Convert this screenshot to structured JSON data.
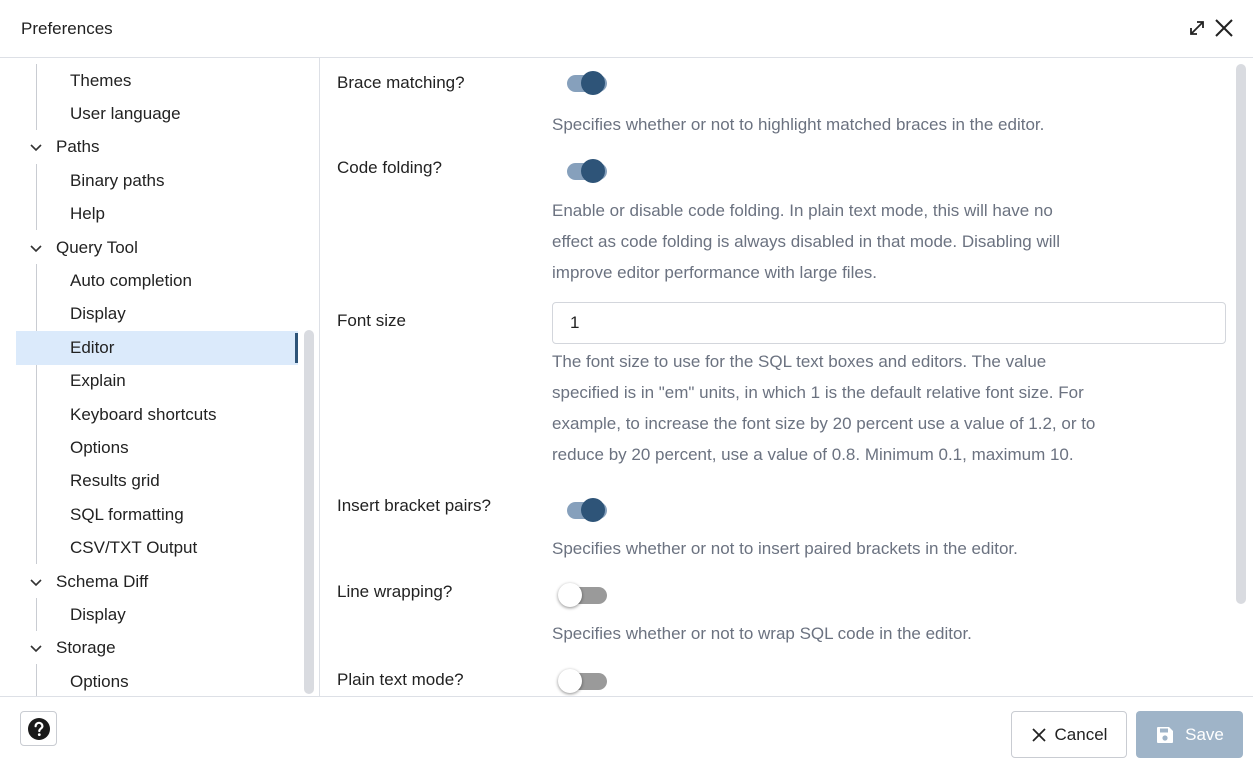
{
  "dialog": {
    "title": "Preferences"
  },
  "tree": {
    "items": [
      {
        "label": "Themes",
        "level": "child"
      },
      {
        "label": "User language",
        "level": "child"
      },
      {
        "label": "Paths",
        "level": "parent",
        "chevron": "⌄"
      },
      {
        "label": "Binary paths",
        "level": "child"
      },
      {
        "label": "Help",
        "level": "child"
      },
      {
        "label": "Query Tool",
        "level": "parent",
        "chevron": "⌄"
      },
      {
        "label": "Auto completion",
        "level": "child"
      },
      {
        "label": "Display",
        "level": "child"
      },
      {
        "label": "Editor",
        "level": "child",
        "selected": true
      },
      {
        "label": "Explain",
        "level": "child"
      },
      {
        "label": "Keyboard shortcuts",
        "level": "child"
      },
      {
        "label": "Options",
        "level": "child"
      },
      {
        "label": "Results grid",
        "level": "child"
      },
      {
        "label": "SQL formatting",
        "level": "child"
      },
      {
        "label": "CSV/TXT Output",
        "level": "child"
      },
      {
        "label": "Schema Diff",
        "level": "parent",
        "chevron": "⌄"
      },
      {
        "label": "Display",
        "level": "child"
      },
      {
        "label": "Storage",
        "level": "parent",
        "chevron": "⌄"
      },
      {
        "label": "Options",
        "level": "child"
      }
    ]
  },
  "settings": {
    "brace_matching": {
      "label": "Brace matching?",
      "enabled": true,
      "description": "Specifies whether or not to highlight matched braces in the editor."
    },
    "code_folding": {
      "label": "Code folding?",
      "enabled": true,
      "description_lines": [
        "Enable or disable code folding. In plain text mode, this will have no",
        "effect as code folding is always disabled in that mode. Disabling will",
        "improve editor performance with large files."
      ]
    },
    "font_size": {
      "label": "Font size",
      "value": "1",
      "description_lines": [
        "The font size to use for the SQL text boxes and editors. The value",
        "specified is in \"em\" units, in which 1 is the default relative font size. For",
        "example, to increase the font size by 20 percent use a value of 1.2, or to",
        "reduce by 20 percent, use a value of 0.8. Minimum 0.1, maximum 10."
      ]
    },
    "insert_bracket_pairs": {
      "label": "Insert bracket pairs?",
      "enabled": true,
      "description": "Specifies whether or not to insert paired brackets in the editor."
    },
    "line_wrapping": {
      "label": "Line wrapping?",
      "enabled": false,
      "description": "Specifies whether or not to wrap SQL code in the editor."
    },
    "plain_text_mode": {
      "label": "Plain text mode?",
      "enabled": false
    }
  },
  "footer": {
    "cancel_label": "Cancel",
    "save_label": "Save"
  },
  "icons": {
    "maximize": "expand-diagonal-icon",
    "close": "close-icon",
    "help": "help-circle-icon",
    "cancel": "x-icon",
    "save": "floppy-disk-icon"
  },
  "colors": {
    "accent": "#2e5478",
    "toggle_on_track": "#86a0bc",
    "selected_bg": "#dbeafb",
    "save_disabled": "#9fb4c8"
  }
}
